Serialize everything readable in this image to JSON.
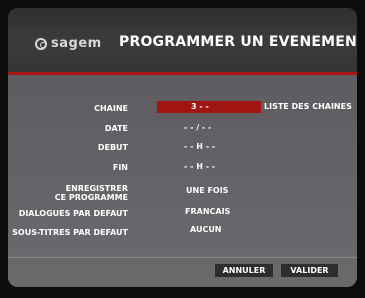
{
  "header": {
    "logo_text": "sagem",
    "title": "PROGRAMMER UN EVENEMENT"
  },
  "form": {
    "chaine": {
      "label": "CHAINE",
      "value": "3 - -",
      "link": "LISTE DES CHAINES"
    },
    "date": {
      "label": "DATE",
      "value": "- - / - -"
    },
    "debut": {
      "label": "DEBUT",
      "value": "- - H - -"
    },
    "fin": {
      "label": "FIN",
      "value": "- - H - -"
    },
    "enregistrer": {
      "label_line1": "ENREGISTRER",
      "label_line2": "CE PROGRAMME",
      "value": "UNE FOIS"
    },
    "dialogues": {
      "label": "DIALOGUES PAR DEFAUT",
      "value": "FRANCAIS"
    },
    "sous_titres": {
      "label": "SOUS-TITRES PAR DEFAUT",
      "value": "AUCUN"
    }
  },
  "footer": {
    "annuler_label": "ANNULER",
    "valider_label": "VALIDER"
  },
  "colors": {
    "accent_red": "#a01512",
    "panel_gray": "#6d6b6d",
    "header_dark": "#343235"
  }
}
